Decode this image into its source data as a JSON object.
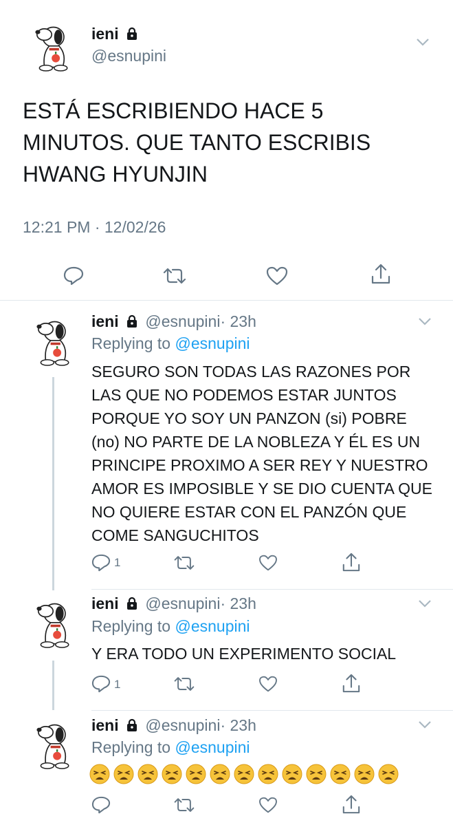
{
  "main_tweet": {
    "name": "ieni",
    "handle": "@esnupini",
    "text": "ESTÁ ESCRIBIENDO HACE 5 MINUTOS. QUE TANTO ESCRIBIS HWANG HYUNJIN",
    "timestamp": "12:21 PM · 12/02/26"
  },
  "replies": [
    {
      "name": "ieni",
      "handle": "@esnupini",
      "time": "· 23h",
      "replying_label": "Replying to",
      "replying_to": "@esnupini",
      "text": "SEGURO SON TODAS LAS RAZONES POR LAS QUE NO PODEMOS ESTAR JUNTOS PORQUE YO SOY UN PANZON (si) POBRE (no) NO PARTE DE LA NOBLEZA Y ÉL ES UN PRINCIPE PROXIMO A SER REY Y NUESTRO AMOR ES IMPOSIBLE Y SE DIO CUENTA QUE NO QUIERE ESTAR CON EL PANZÓN QUE COME SANGUCHITOS",
      "reply_count": "1"
    },
    {
      "name": "ieni",
      "handle": "@esnupini",
      "time": "· 23h",
      "replying_label": "Replying to",
      "replying_to": "@esnupini",
      "text": "Y ERA TODO UN EXPERIMENTO SOCIAL",
      "reply_count": "1"
    },
    {
      "name": "ieni",
      "handle": "@esnupini",
      "time": "· 23h",
      "replying_label": "Replying to",
      "replying_to": "@esnupini",
      "emoji_count": 13,
      "emoji_name": "weary-face"
    }
  ],
  "colors": {
    "icon_gray": "#657786",
    "link_blue": "#1da1f2",
    "divider": "#e1e8ed",
    "thread_line": "#ccd6dd",
    "emoji_yellow": "#f6c33a"
  }
}
